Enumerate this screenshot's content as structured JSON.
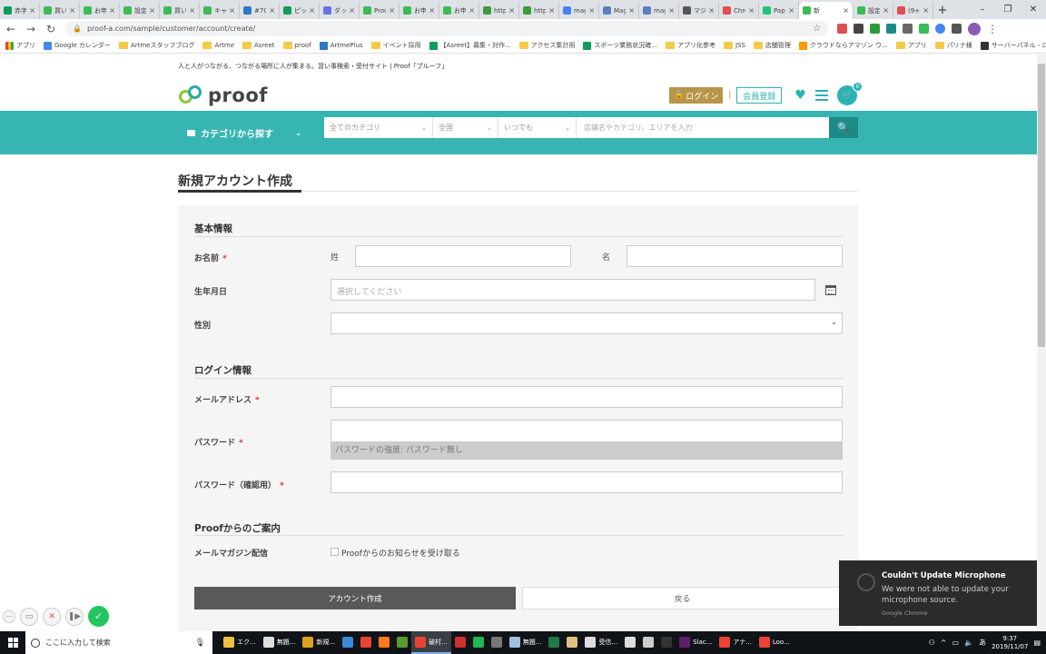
{
  "browser": {
    "tabs": [
      {
        "label": "赤字",
        "color": "#0f9d58"
      },
      {
        "label": "買い手",
        "color": "#3cba54"
      },
      {
        "label": "お申し",
        "color": "#3cba54"
      },
      {
        "label": "設定",
        "color": "#3cba54"
      },
      {
        "label": "買い手",
        "color": "#3cba54"
      },
      {
        "label": "キャン",
        "color": "#3cba54"
      },
      {
        "label": "#707",
        "color": "#2b78c5"
      },
      {
        "label": "ピック",
        "color": "#0f9d58"
      },
      {
        "label": "ダッシ",
        "color": "#6772e5"
      },
      {
        "label": "Proof",
        "color": "#3cba54"
      },
      {
        "label": "お申し",
        "color": "#3cba54"
      },
      {
        "label": "お申し",
        "color": "#3cba54"
      },
      {
        "label": "https",
        "color": "#3c9b3c"
      },
      {
        "label": "https",
        "color": "#3c9b3c"
      },
      {
        "label": "mage",
        "color": "#4285f4"
      },
      {
        "label": "Mage",
        "color": "#5b7fbf"
      },
      {
        "label": "mage",
        "color": "#5b7fbf"
      },
      {
        "label": "マジェ",
        "color": "#555555"
      },
      {
        "label": "Chron",
        "color": "#e05050"
      },
      {
        "label": "Papag",
        "color": "#1ec47a"
      },
      {
        "label": "新",
        "color": "#3cba54",
        "active": true
      },
      {
        "label": "設定",
        "color": "#3cba54"
      },
      {
        "label": "(9+)",
        "color": "#e05050"
      }
    ],
    "new_tab": "+",
    "window_controls": {
      "minimize": "–",
      "restore": "❐",
      "close": "✕"
    },
    "url": "proof-a.com/sample/customer/account/create/",
    "bookmarks": [
      {
        "label": "アプリ",
        "type": "apps"
      },
      {
        "label": "Google カレンダー",
        "type": "icon",
        "color": "#4285f4"
      },
      {
        "label": "Artmeスタッフブログ",
        "type": "folder"
      },
      {
        "label": "Artme",
        "type": "folder"
      },
      {
        "label": "Asreet",
        "type": "folder"
      },
      {
        "label": "proof",
        "type": "folder"
      },
      {
        "label": "ArtmePlus",
        "type": "icon",
        "color": "#2b78c5"
      },
      {
        "label": "イベント採用",
        "type": "folder"
      },
      {
        "label": "【Asreet】募集・対作...",
        "type": "icon",
        "color": "#0f9d58"
      },
      {
        "label": "アクセス集計用",
        "type": "folder"
      },
      {
        "label": "スポーツ業務状況確...",
        "type": "icon",
        "color": "#0f9d58"
      },
      {
        "label": "アプリ化参考",
        "type": "folder"
      },
      {
        "label": "JSS",
        "type": "folder"
      },
      {
        "label": "店舗管理",
        "type": "folder"
      },
      {
        "label": "クラウドならアマゾン ウ...",
        "type": "icon",
        "color": "#ff9900"
      },
      {
        "label": "アプリ",
        "type": "folder"
      },
      {
        "label": "パリナ様",
        "type": "folder"
      },
      {
        "label": "サーバーパネル - ログイ...",
        "type": "icon",
        "color": "#333333"
      }
    ],
    "more_bookmarks": "»"
  },
  "site": {
    "tagline": "人と人がつながる、つながる場所に人が集まる。習い事検索・受付サイト | Proof「プルーフ」",
    "logo_text": "proof",
    "login_label": "ログイン",
    "separator": "|",
    "register_label": "会員登録",
    "cart_count": "0",
    "category_button": "カテゴリから探す",
    "search": {
      "category": "全てのカテゴリ",
      "area": "全国",
      "time": "いつでも",
      "placeholder": "店舗名やカテゴリ、エリアを入力"
    },
    "colors": {
      "teal": "#37b5b3",
      "gold": "#b8954a",
      "lime": "#8dc63f"
    }
  },
  "form": {
    "page_title": "新規アカウント作成",
    "required_mark": "*",
    "sections": {
      "basic": "基本情報",
      "login": "ログイン情報",
      "proof": "Proofからのご案内"
    },
    "fields": {
      "name": {
        "label": "お名前",
        "last_label": "姓",
        "first_label": "名"
      },
      "birthday": {
        "label": "生年月日",
        "placeholder": "選択してください"
      },
      "gender": {
        "label": "性別",
        "value": ""
      },
      "email": {
        "label": "メールアドレス"
      },
      "password": {
        "label": "パスワード",
        "strength": "パスワードの強度: パスワード無し"
      },
      "password_confirm": {
        "label": "パスワード（確認用）"
      },
      "newsletter": {
        "label": "メールマガジン配信",
        "checkbox_label": "Proofからのお知らせを受け取る"
      }
    },
    "submit_label": "アカウント作成",
    "back_label": "戻る"
  },
  "toast": {
    "title": "Couldn't Update Microphone",
    "body": "We were not able to update your microphone source.",
    "source": "Google Chrome"
  },
  "taskbar": {
    "search_placeholder": "ここに入力して検索",
    "apps": [
      {
        "label": "エク...",
        "color": "#f0c040"
      },
      {
        "label": "無題...",
        "color": "#dddddd"
      },
      {
        "label": "新規...",
        "color": "#e0a020"
      },
      {
        "label": "",
        "color": "#3a8ad8"
      },
      {
        "label": "",
        "color": "#ea4335"
      },
      {
        "label": "",
        "color": "#ff7a18"
      },
      {
        "label": "",
        "color": "#5c9a2f"
      },
      {
        "label": "破村...",
        "color": "#ea4335",
        "active": true
      },
      {
        "label": "",
        "color": "#d03030"
      },
      {
        "label": "",
        "color": "#1db954"
      },
      {
        "label": "",
        "color": "#777777"
      },
      {
        "label": "無題...",
        "color": "#a0c0e0"
      },
      {
        "label": "",
        "color": "#1d7a45"
      },
      {
        "label": "",
        "color": "#e0c080"
      },
      {
        "label": "受信...",
        "color": "#dddddd"
      },
      {
        "label": "",
        "color": "#dddddd"
      },
      {
        "label": "",
        "color": "#cccccc"
      },
      {
        "label": "",
        "color": "#333333"
      },
      {
        "label": "Slac...",
        "color": "#611f69"
      },
      {
        "label": "アナ...",
        "color": "#ea4335"
      },
      {
        "label": "Loo...",
        "color": "#ea4335"
      }
    ],
    "time": "9:37",
    "date": "2019/11/07"
  }
}
